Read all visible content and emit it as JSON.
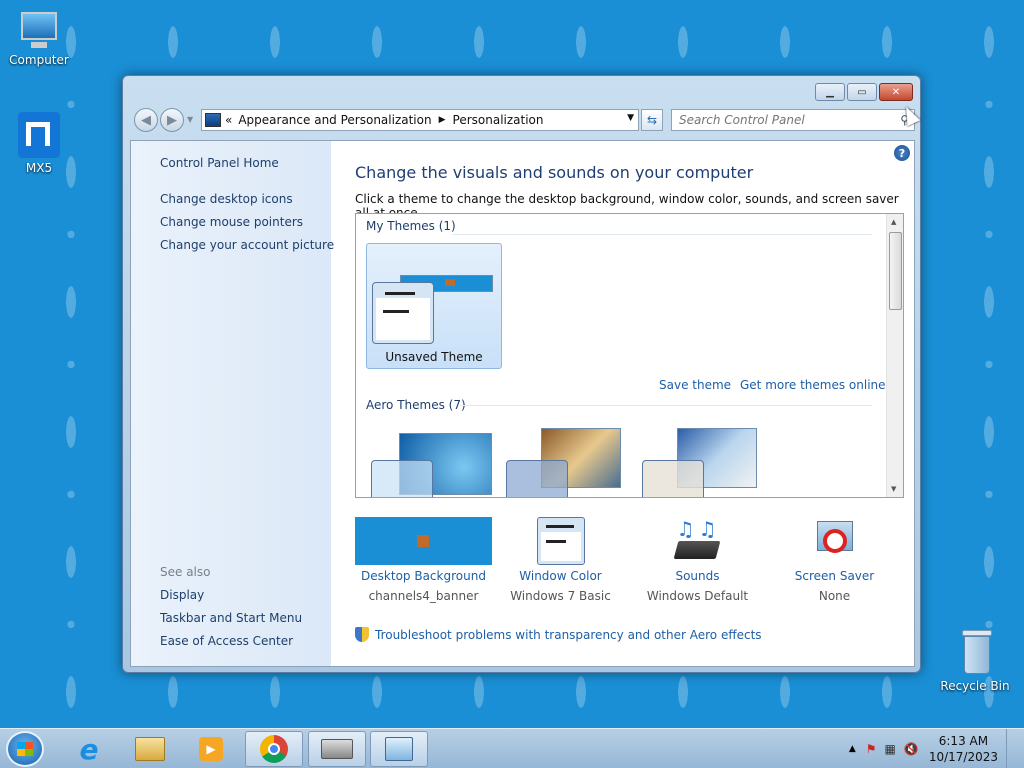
{
  "desktop": {
    "icons": [
      {
        "label": "Computer"
      },
      {
        "label": "MX5"
      },
      {
        "label": "Recycle Bin"
      }
    ]
  },
  "window": {
    "address": {
      "chevron": "«",
      "crumbs": [
        "Appearance and Personalization",
        "Personalization"
      ]
    },
    "search_placeholder": "Search Control Panel"
  },
  "left_pane": {
    "home": "Control Panel Home",
    "links": [
      "Change desktop icons",
      "Change mouse pointers",
      "Change your account picture"
    ],
    "see_also_label": "See also",
    "see_also": [
      "Display",
      "Taskbar and Start Menu",
      "Ease of Access Center"
    ]
  },
  "main": {
    "heading": "Change the visuals and sounds on your computer",
    "subheading": "Click a theme to change the desktop background, window color, sounds, and screen saver all at once.",
    "my_themes_label": "My Themes (1)",
    "unsaved_theme_label": "Unsaved Theme",
    "save_theme": "Save theme",
    "get_more": "Get more themes online",
    "aero_themes_label": "Aero Themes (7)",
    "bottom": [
      {
        "label": "Desktop Background",
        "value": "channels4_banner"
      },
      {
        "label": "Window Color",
        "value": "Windows 7 Basic"
      },
      {
        "label": "Sounds",
        "value": "Windows Default"
      },
      {
        "label": "Screen Saver",
        "value": "None"
      }
    ],
    "troubleshoot": "Troubleshoot problems with transparency and other Aero effects"
  },
  "taskbar": {
    "time": "6:13 AM",
    "date": "10/17/2023"
  },
  "colors": {
    "link": "#1e5fa6",
    "heading": "#1e3e74",
    "desktop": "#1a8fd6"
  }
}
